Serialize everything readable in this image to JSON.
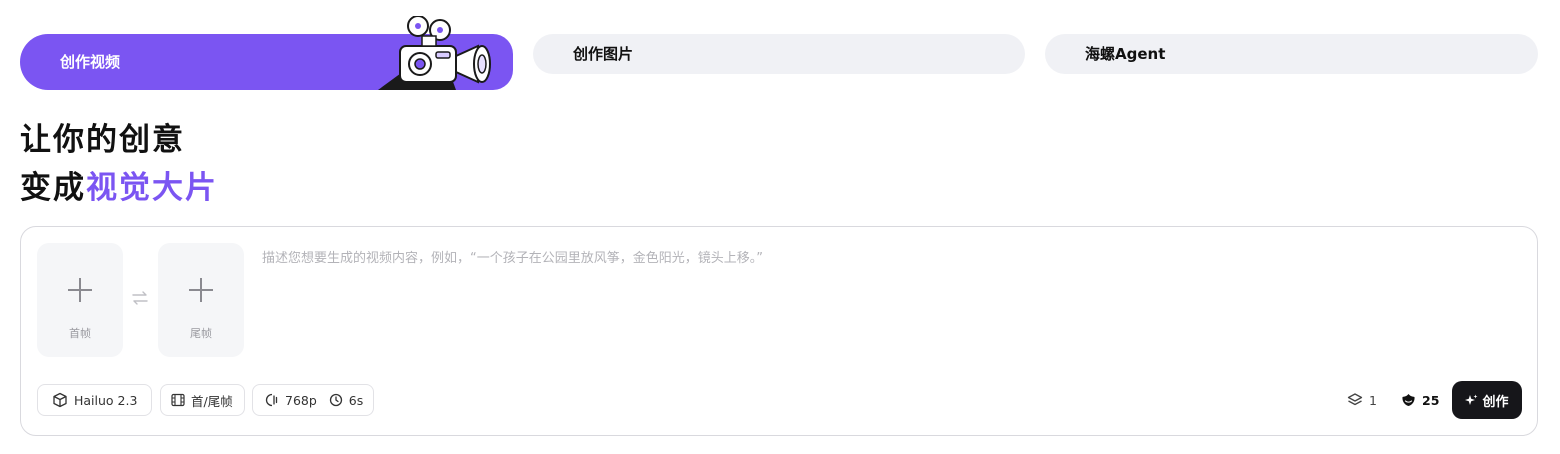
{
  "tabs": [
    {
      "label": "创作视频",
      "active": true
    },
    {
      "label": "创作图片",
      "active": false
    },
    {
      "label": "海螺Agent",
      "active": false
    }
  ],
  "headline": {
    "line1": "让你的创意",
    "line2_prefix": "变成",
    "line2_accent": "视觉大片"
  },
  "composer": {
    "first_frame_label": "首帧",
    "last_frame_label": "尾帧",
    "prompt_placeholder": "描述您想要生成的视频内容，例如，“一个孩子在公园里放风筝，金色阳光，镜头上移。”",
    "prompt_value": "",
    "model_label": "Hailuo 2.3",
    "mode_label": "首/尾帧",
    "resolution_label": "768p",
    "duration_label": "6s",
    "count_label": "1",
    "credits_label": "25",
    "create_label": "创作"
  },
  "colors": {
    "accent": "#7b55f2",
    "button_dark": "#16161a",
    "tab_bg": "#f0f1f5"
  },
  "icons": {
    "camera": "camera-illustration",
    "model": "cube-icon",
    "mode": "film-icon",
    "resolution": "aspect-icon",
    "duration": "clock-icon",
    "count": "layers-icon",
    "credits": "credits-icon",
    "create": "sparkle-icon",
    "swap": "swap-icon"
  }
}
